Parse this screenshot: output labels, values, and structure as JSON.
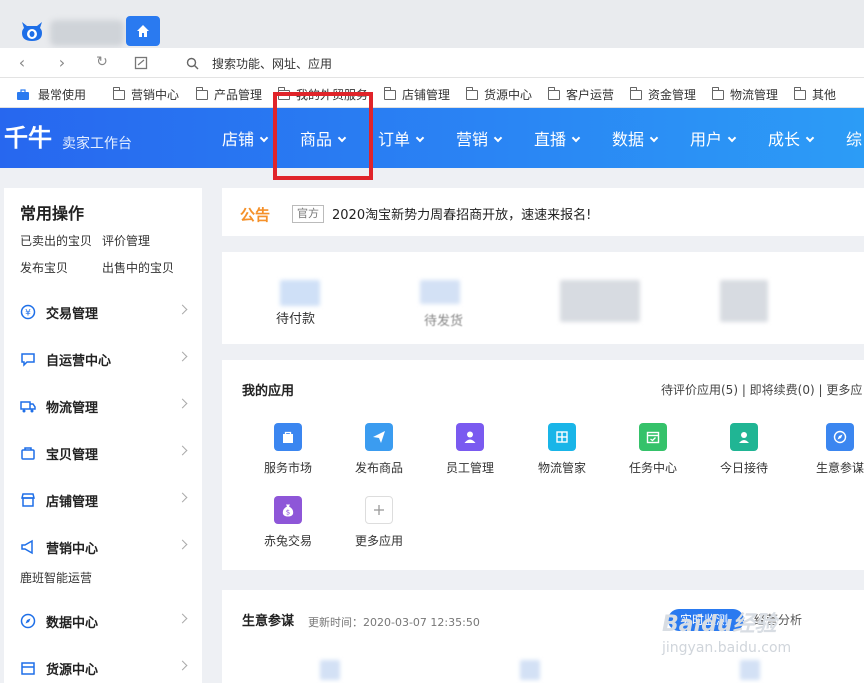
{
  "browser": {
    "address_placeholder": "搜索功能、网址、应用",
    "bookmarks": [
      "最常使用",
      "营销中心",
      "产品管理",
      "我的外贸服务",
      "店铺管理",
      "货源中心",
      "客户运营",
      "资金管理",
      "物流管理",
      "其他"
    ]
  },
  "header": {
    "brand": "千牛",
    "brand_sub": "卖家工作台",
    "menu": [
      "店铺",
      "商品",
      "订单",
      "营销",
      "直播",
      "数据",
      "用户",
      "成长",
      "综"
    ]
  },
  "sidebar": {
    "title": "常用操作",
    "quick_links": [
      "已卖出的宝贝",
      "评价管理",
      "发布宝贝",
      "出售中的宝贝"
    ],
    "items": [
      "交易管理",
      "自运营中心",
      "物流管理",
      "宝贝管理",
      "店铺管理",
      "营销中心",
      "数据中心",
      "货源中心"
    ],
    "marketing_sub": "鹿班智能运营"
  },
  "notice": {
    "label": "公告",
    "tag": "官方",
    "text": "2020淘宝新势力周春招商开放，速速来报名!"
  },
  "stats": {
    "items": [
      "待付款",
      "待发货"
    ]
  },
  "apps": {
    "title": "我的应用",
    "right_links": "待评价应用(5)  |  即将续费(0)  |  更多应",
    "tiles": [
      {
        "name": "服务市场",
        "color": "#3b86f0",
        "icon": "bag-icon"
      },
      {
        "name": "发布商品",
        "color": "#3b9cf0",
        "icon": "send-icon"
      },
      {
        "name": "员工管理",
        "color": "#7a5af0",
        "icon": "person-icon"
      },
      {
        "name": "物流管家",
        "color": "#19b5e8",
        "icon": "logistics-icon"
      },
      {
        "name": "任务中心",
        "color": "#35c26a",
        "icon": "calendar-icon"
      },
      {
        "name": "今日接待",
        "color": "#20b594",
        "icon": "reception-icon"
      },
      {
        "name": "生意参谋",
        "color": "#3b86f0",
        "icon": "compass-icon"
      },
      {
        "name": "赤兔交易",
        "color": "#8e56d8",
        "icon": "money-bag-icon"
      },
      {
        "name": "更多应用",
        "color": "#ffffff",
        "icon": "plus-icon"
      }
    ]
  },
  "business": {
    "title": "生意参谋",
    "updated": "更新时间：2020-03-07 12:35:50",
    "toggle_on": "实时监测",
    "toggle_off": "经营分析"
  },
  "watermark": {
    "text": "Baidu经验",
    "url": "jingyan.baidu.com"
  },
  "colors": {
    "accent": "#2a7af0",
    "highlight": "#e0242a",
    "notice": "#f5912a"
  }
}
